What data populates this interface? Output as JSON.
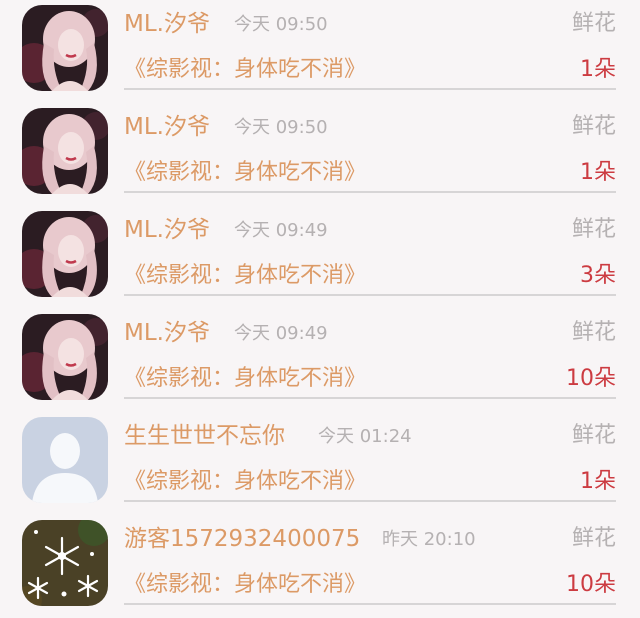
{
  "gifts": [
    {
      "sender": "ML.汐爷",
      "time": "今天 09:50",
      "gift_type": "鲜花",
      "work": "《综影视：身体吃不消》",
      "count": "1朵",
      "avatar_icon": "portrait-avatar-icon"
    },
    {
      "sender": "ML.汐爷",
      "time": "今天 09:50",
      "gift_type": "鲜花",
      "work": "《综影视：身体吃不消》",
      "count": "1朵",
      "avatar_icon": "portrait-avatar-icon"
    },
    {
      "sender": "ML.汐爷",
      "time": "今天 09:49",
      "gift_type": "鲜花",
      "work": "《综影视：身体吃不消》",
      "count": "3朵",
      "avatar_icon": "portrait-avatar-icon"
    },
    {
      "sender": "ML.汐爷",
      "time": "今天 09:49",
      "gift_type": "鲜花",
      "work": "《综影视：身体吃不消》",
      "count": "10朵",
      "avatar_icon": "portrait-avatar-icon"
    },
    {
      "sender": "生生世世不忘你",
      "time": "今天 01:24",
      "gift_type": "鲜花",
      "work": "《综影视：身体吃不消》",
      "count": "1朵",
      "avatar_icon": "default-user-avatar-icon"
    },
    {
      "sender": "游客1572932400075",
      "time": "昨天 20:10",
      "gift_type": "鲜花",
      "work": "《综影视：身体吃不消》",
      "count": "10朵",
      "avatar_icon": "snowflake-avatar-icon"
    }
  ],
  "colors": {
    "accent": "#dc9a66",
    "count": "#cc3b41",
    "muted": "#b5b1b2",
    "divider": "#d7d5d6",
    "background": "#f8f5f6"
  }
}
